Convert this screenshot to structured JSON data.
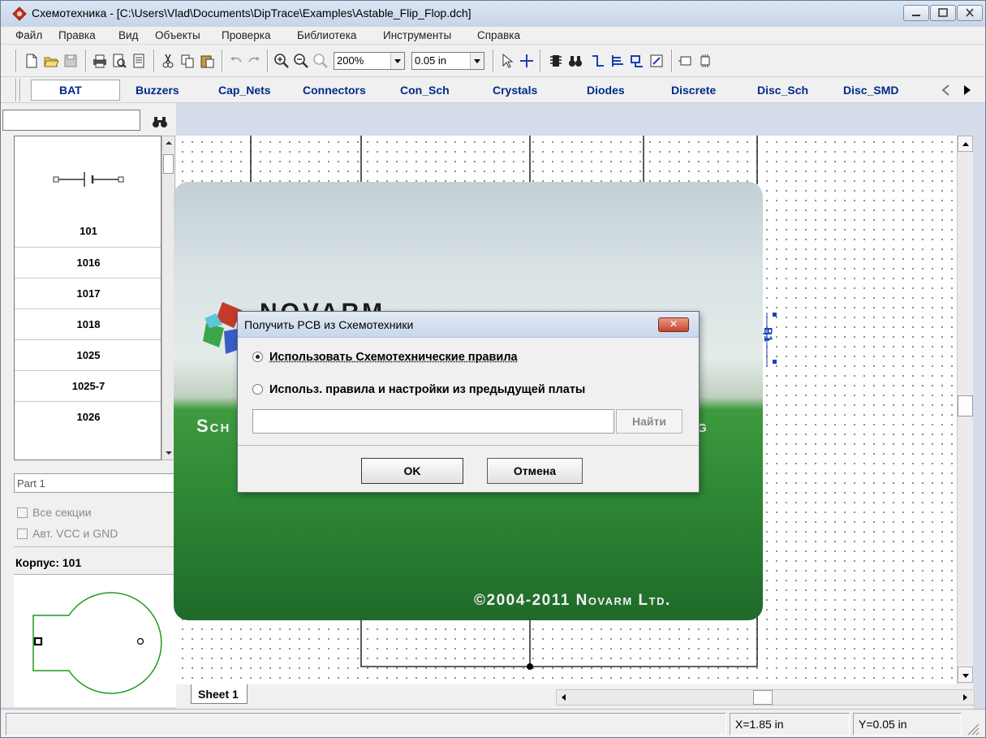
{
  "window": {
    "title": "Схемотехника - [C:\\Users\\Vlad\\Documents\\DipTrace\\Examples\\Astable_Flip_Flop.dch]"
  },
  "menu": [
    "Файл",
    "Правка",
    "Вид",
    "Объекты",
    "Проверка",
    "Библиотека",
    "Инструменты",
    "Справка"
  ],
  "toolbar": {
    "zoom": "200%",
    "grid": "0.05 in"
  },
  "libraries": [
    "BAT",
    "Buzzers",
    "Cap_Nets",
    "Connectors",
    "Con_Sch",
    "Crystals",
    "Diodes",
    "Discrete",
    "Disc_Sch",
    "Disc_SMD"
  ],
  "components": [
    "101",
    "1016",
    "1017",
    "1018",
    "1025",
    "1025-7",
    "1026"
  ],
  "part_panel": {
    "part": "Part 1",
    "all_sections": "Все секции",
    "auto_vcc_gnd": "Авт. VCC и GND",
    "package_label": "Корпус: 101"
  },
  "canvas": {
    "sheet_tab": "Sheet 1",
    "component_ref": "B1"
  },
  "status": {
    "x": "X=1.85 in",
    "y": "Y=0.05 in"
  },
  "splash": {
    "brand": "NOVARM",
    "subtitle_left": "Sch",
    "subtitle_right": "ng",
    "copyright": "©2004-2011 Novarm Ltd."
  },
  "dialog": {
    "title": "Получить PCB из Схемотехники",
    "option1": "Использовать Схемотехнические правила",
    "option2": "Использ. правила и настройки из предыдущей платы",
    "find_label": "Найти",
    "ok_label": "OK",
    "cancel_label": "Отмена"
  }
}
